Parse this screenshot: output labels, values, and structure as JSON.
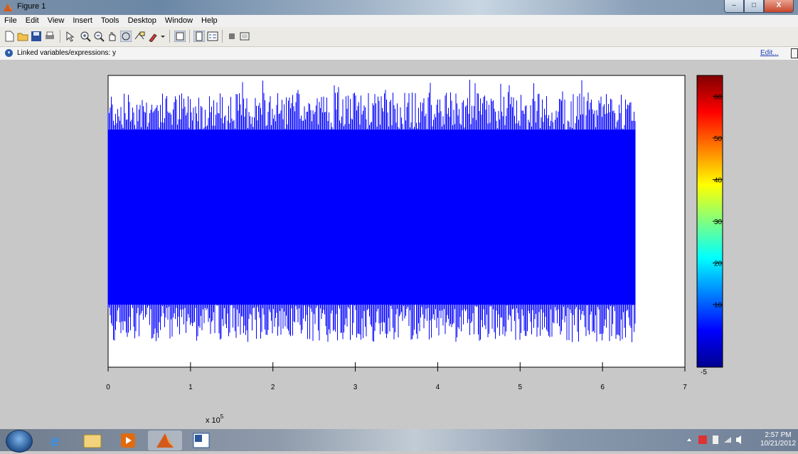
{
  "window": {
    "title": "Figure 1",
    "buttons": [
      "–",
      "□",
      "X"
    ]
  },
  "menu": [
    "File",
    "Edit",
    "View",
    "Insert",
    "Tools",
    "Desktop",
    "Window",
    "Help"
  ],
  "toolbar": {
    "icons": [
      "new-file-icon",
      "open-folder-icon",
      "save-icon",
      "print-icon",
      "pointer-icon",
      "zoom-in-icon",
      "zoom-out-icon",
      "pan-icon",
      "rotate-3d-icon",
      "data-cursor-icon",
      "brush-icon",
      "brush-dropdown-icon",
      "link-plot-icon",
      "colorbar-icon",
      "legend-icon",
      "hide-plot-tools-icon",
      "show-plot-tools-icon"
    ]
  },
  "linkbar": {
    "text": "Linked variables/expressions: y",
    "edit": "Edit..."
  },
  "chart_data": {
    "type": "line",
    "description_series": "dense signal y",
    "x_multiplier_label": "x 10",
    "x_multiplier_exp": "5",
    "xlim": [
      0,
      7
    ],
    "xticks": [
      "0",
      "1",
      "2",
      "3",
      "4",
      "5",
      "6",
      "7"
    ],
    "ylim": [
      -5,
      65
    ],
    "signal": {
      "x_start": 0,
      "x_end": 6.4,
      "envelope_low": 2,
      "envelope_high": 58,
      "max": 64,
      "min": 1,
      "color": "#0000ff"
    },
    "colorbar": {
      "ticks": [
        "60",
        "50",
        "40",
        "30",
        "20",
        "10",
        "-5"
      ],
      "range": [
        -5,
        65
      ]
    }
  },
  "taskbar": {
    "apps": [
      "start-orb",
      "internet-explorer",
      "windows-explorer",
      "media-player",
      "matlab",
      "word"
    ],
    "clock": {
      "time": "2:57 PM",
      "date": "10/21/2012"
    }
  }
}
